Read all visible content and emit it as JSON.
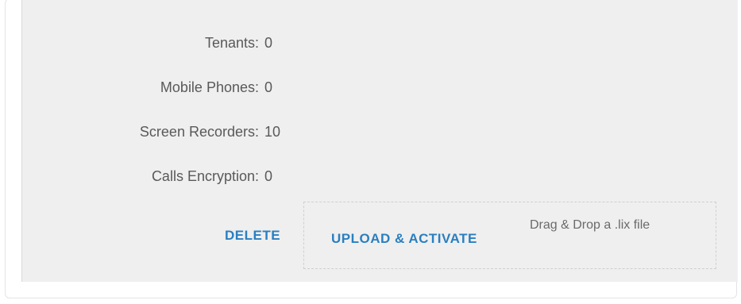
{
  "stats": [
    {
      "label": "Tenants:",
      "value": "0"
    },
    {
      "label": "Mobile Phones:",
      "value": "0"
    },
    {
      "label": "Screen Recorders:",
      "value": "10"
    },
    {
      "label": "Calls Encryption:",
      "value": "0"
    }
  ],
  "actions": {
    "delete_label": "DELETE",
    "upload_label": "UPLOAD & ACTIVATE",
    "drop_hint": "Drag & Drop a .lix file"
  },
  "colors": {
    "accent": "#2a7fc0",
    "panel_bg": "#efefef",
    "text": "#595959"
  }
}
